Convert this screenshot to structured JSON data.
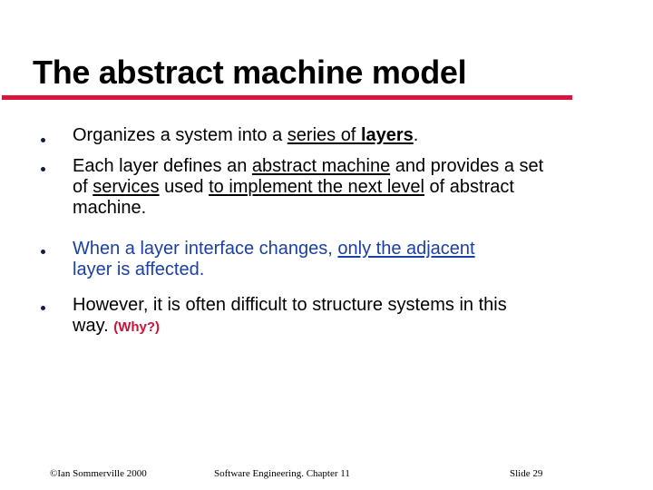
{
  "slide": {
    "title": "The abstract machine model",
    "accent_color": "#dc143c",
    "bullets": [
      {
        "parts": [
          {
            "text": "Organizes a system into a ",
            "style": ""
          },
          {
            "text": "series of ",
            "style": "u"
          },
          {
            "text": "layers",
            "style": "u b"
          },
          {
            "text": ".",
            "style": ""
          }
        ]
      },
      {
        "parts": [
          {
            "text": "Each layer defines an ",
            "style": ""
          },
          {
            "text": "abstract machine",
            "style": "u"
          },
          {
            "text": " and provides a set of ",
            "style": ""
          },
          {
            "text": "services",
            "style": "u"
          },
          {
            "text": " used ",
            "style": ""
          },
          {
            "text": "to implement the next level",
            "style": "u"
          },
          {
            "text": " of abstract machine.",
            "style": ""
          }
        ]
      },
      {
        "parts": [
          {
            "text": "When a layer interface changes, ",
            "style": "blue"
          },
          {
            "text": "only the adjacent",
            "style": "blue u"
          },
          {
            "text": " layer is affected.",
            "style": "blue"
          }
        ]
      },
      {
        "parts": [
          {
            "text": "However, it is often difficult to structure systems in this way. ",
            "style": ""
          },
          {
            "text": "(Why?)",
            "style": "why"
          }
        ]
      }
    ]
  },
  "footer": {
    "copyright": "©Ian Sommerville 2000",
    "course": "Software Engineering. Chapter 11",
    "slide_number": "Slide 29"
  }
}
